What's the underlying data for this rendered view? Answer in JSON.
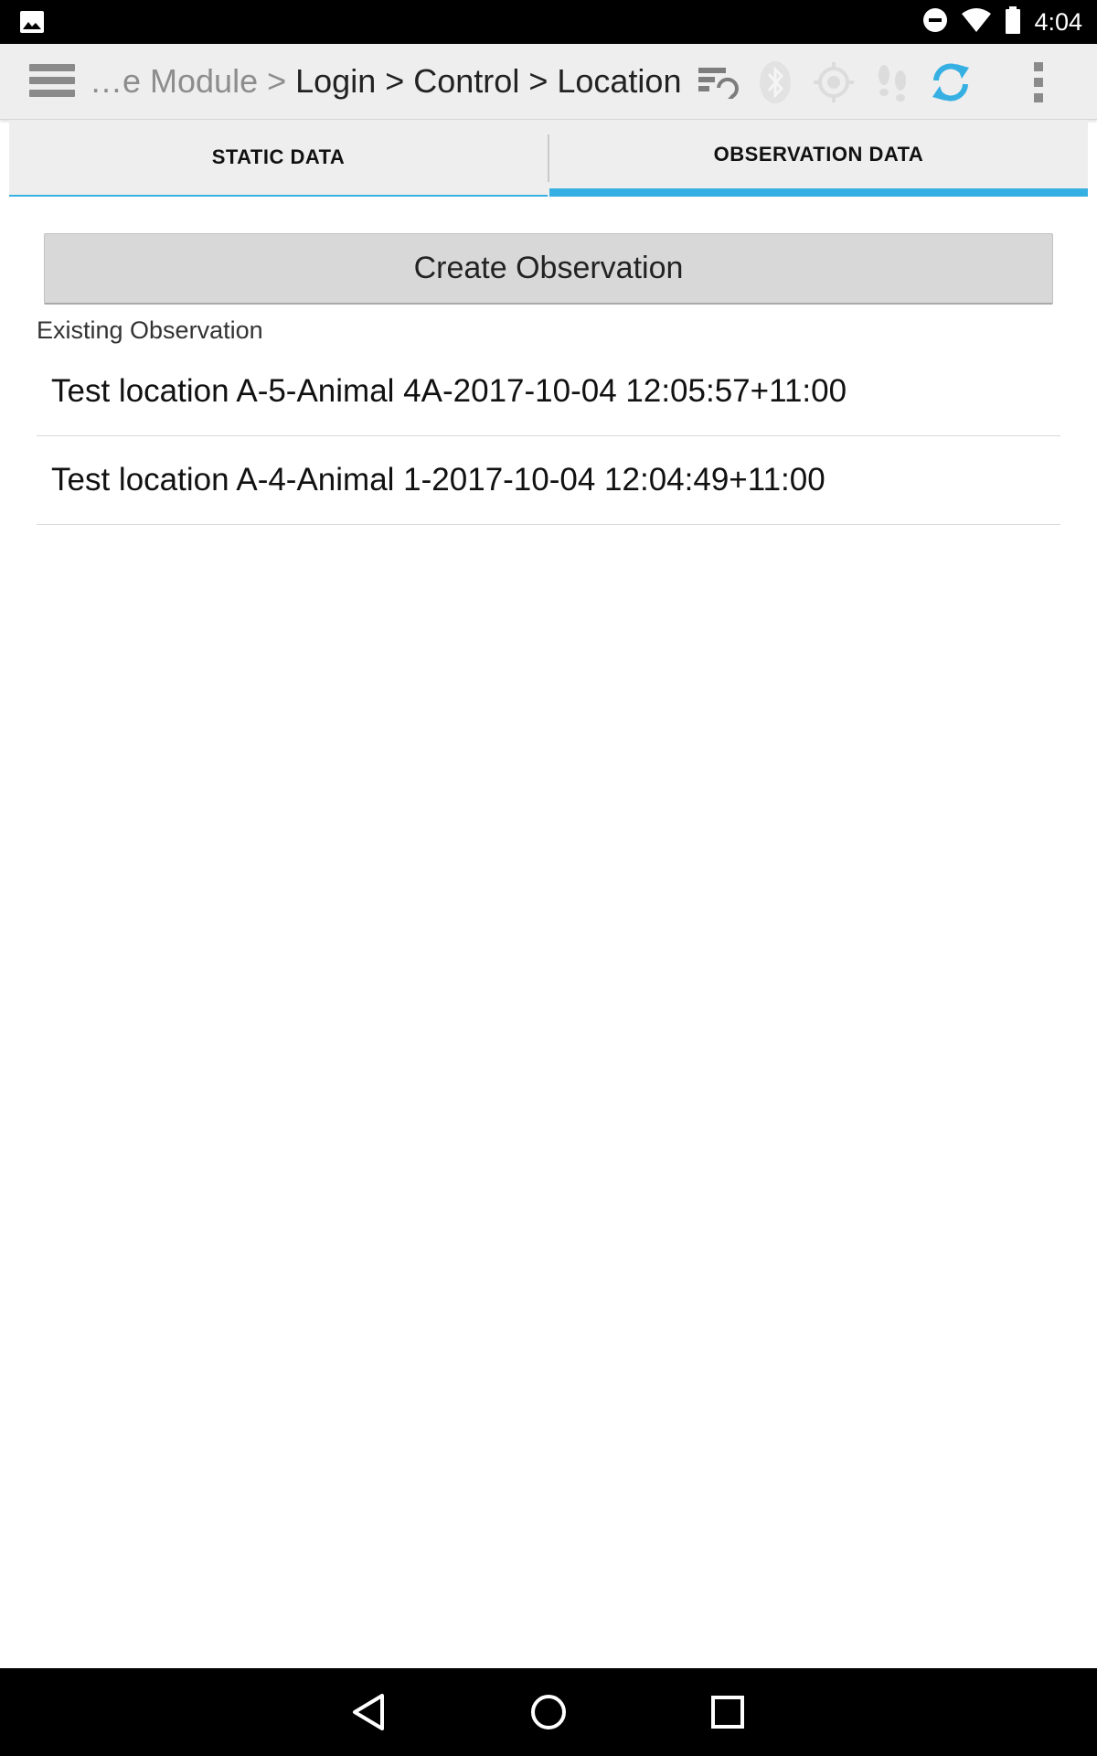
{
  "status_bar": {
    "time": "4:04",
    "icons": [
      "image-icon",
      "do-not-disturb-icon",
      "wifi-icon",
      "battery-icon"
    ]
  },
  "action_bar": {
    "breadcrumb": {
      "truncated": "…e Module",
      "separator": ">",
      "items": [
        "Login",
        "Control",
        "Location"
      ]
    },
    "icons": [
      "menu-icon",
      "sync-list-icon",
      "bluetooth-icon",
      "gps-icon",
      "footsteps-icon",
      "refresh-icon",
      "overflow-menu-icon"
    ],
    "accent_color": "#36b0e3"
  },
  "tabs": [
    {
      "label": "STATIC DATA",
      "selected": false
    },
    {
      "label": "OBSERVATION DATA",
      "selected": true
    }
  ],
  "main": {
    "create_button_label": "Create Observation",
    "existing_label": "Existing Observation",
    "observations": [
      "Test location A-5-Animal 4A-2017-10-04 12:05:57+11:00",
      "Test location A-4-Animal 1-2017-10-04 12:04:49+11:00"
    ]
  },
  "nav_bar": {
    "icons": [
      "back-icon",
      "home-icon",
      "recents-icon"
    ]
  }
}
